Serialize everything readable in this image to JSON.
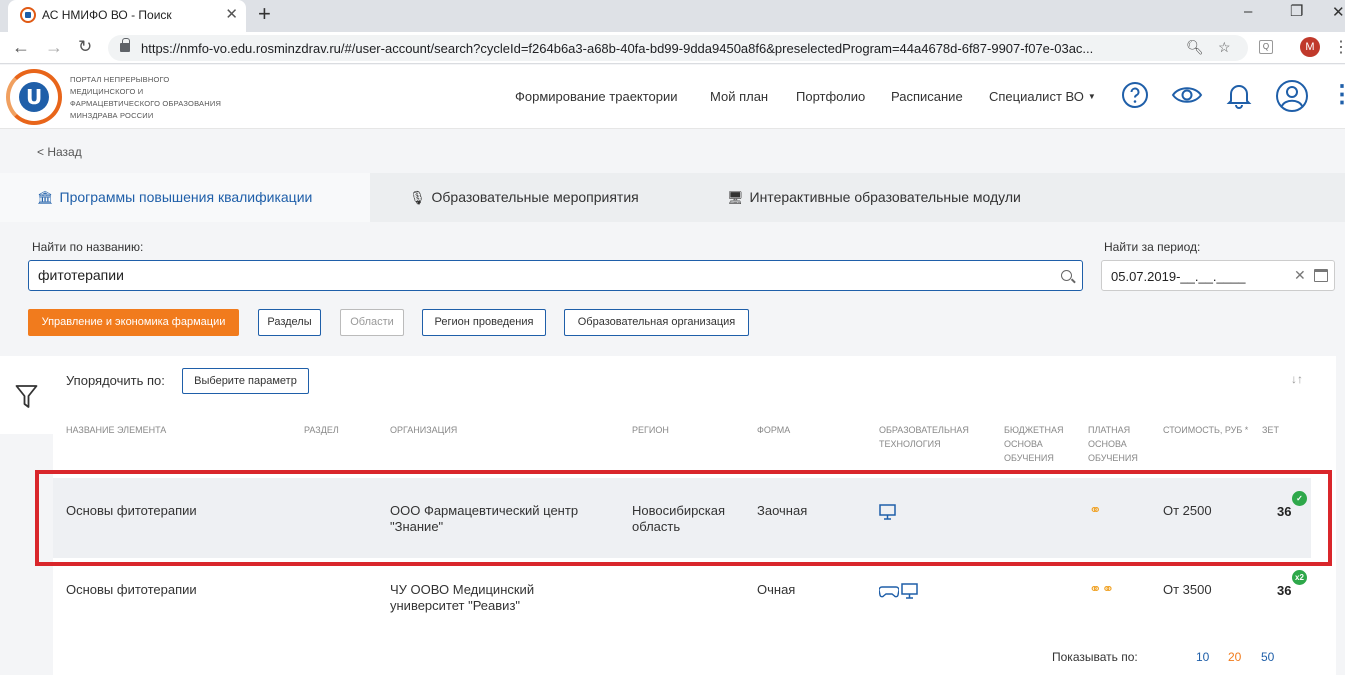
{
  "browser": {
    "tab_title": "АС НМИФО ВО - Поиск",
    "tab_close": "✕",
    "new_tab": "+",
    "url": "https://nmfo-vo.edu.rosminzdrav.ru/#/user-account/search?cycleId=f264b6a3-a68b-40fa-bd99-9dda9450a8f6&preselectedProgram=44a4678d-6f87-9907-f07e-03ac...",
    "profile_initial": "M"
  },
  "header": {
    "logo_text": "Портал непрерывного медицинского и фармацевтического образования Минздрава России",
    "nav": [
      "Формирование траектории",
      "Мой план",
      "Портфолио",
      "Расписание",
      "Специалист ВО"
    ]
  },
  "back_link": "< Назад",
  "tabs": [
    {
      "label": "Программы повышения квалификации",
      "icon": "bank-icon"
    },
    {
      "label": "Образовательные мероприятия",
      "icon": "microphone-icon"
    },
    {
      "label": "Интерактивные образовательные модули",
      "icon": "monitor-icon"
    }
  ],
  "search": {
    "label": "Найти по названию:",
    "value": "фитотерапии",
    "period_label": "Найти за период:",
    "period_value": "05.07.2019-__.__.____"
  },
  "filters": [
    "Управление и экономика фармации",
    "Разделы",
    "Области",
    "Регион проведения",
    "Образовательная организация"
  ],
  "sort": {
    "label": "Упорядочить по:",
    "button": "Выберите параметр"
  },
  "table": {
    "headers": [
      "Название элемента",
      "Раздел",
      "Организация",
      "Регион",
      "Форма",
      "Образовательная технология",
      "Бюджетная основа обучения",
      "Платная основа обучения",
      "Стоимость, руб *",
      "Зет"
    ],
    "rows": [
      {
        "name": "Основы фитотерапии",
        "section": "",
        "org": "ООО Фармацевтический центр \"Знание\"",
        "region": "Новосибирская область",
        "form": "Заочная",
        "price": "От 2500",
        "zet": "36",
        "badge": "✓"
      },
      {
        "name": "Основы фитотерапии",
        "section": "",
        "org": "ЧУ ООВО Медицинский университет \"Реавиз\"",
        "region": "",
        "form": "Очная",
        "price": "От 3500",
        "zet": "36",
        "badge": "x2"
      }
    ]
  },
  "pager": {
    "label": "Показывать по:",
    "options": [
      "10",
      "20",
      "50"
    ],
    "selected": "20"
  },
  "colors": {
    "accent": "#1f5fa9",
    "orange": "#f17b1d",
    "highlight": "#d9262b",
    "success": "#2ea84a"
  }
}
